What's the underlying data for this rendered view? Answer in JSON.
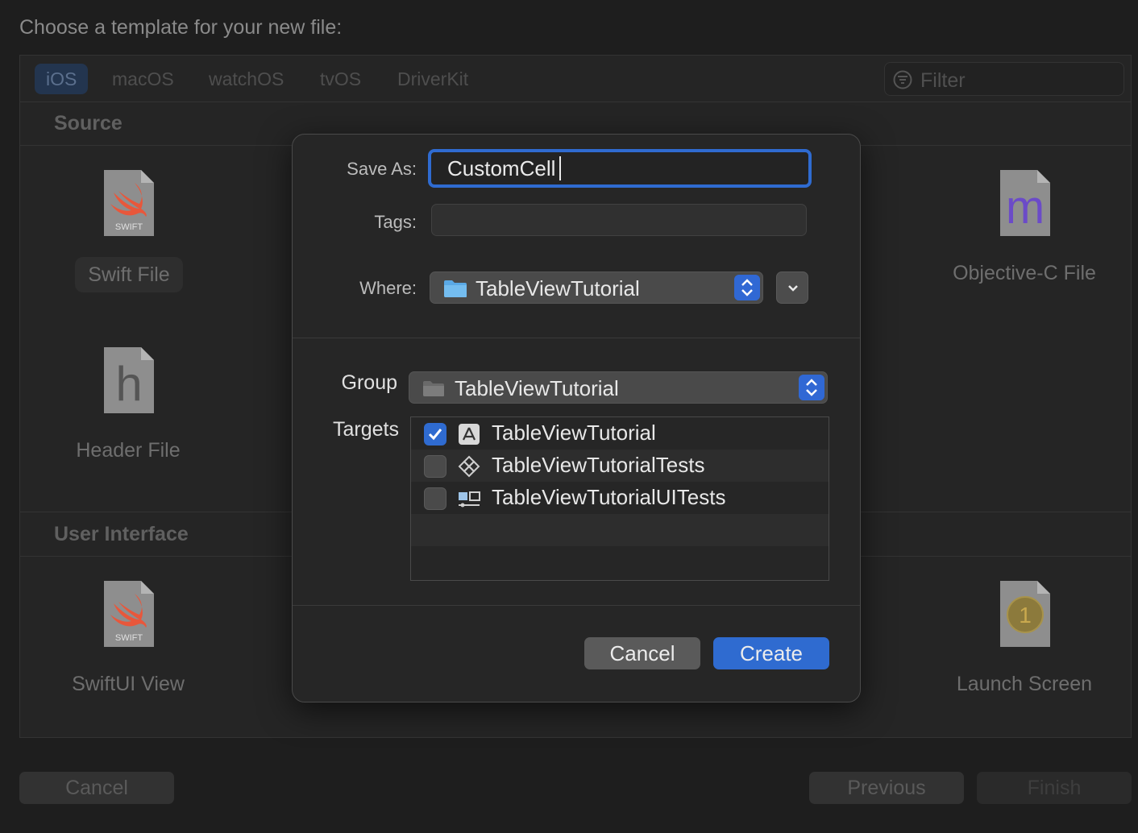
{
  "heading": "Choose a template for your new file:",
  "platforms": [
    "iOS",
    "macOS",
    "watchOS",
    "tvOS",
    "DriverKit"
  ],
  "filter_placeholder": "Filter",
  "sections": {
    "source": "Source",
    "user_interface": "User Interface"
  },
  "templates": {
    "swift_file": "Swift File",
    "objc_file": "Objective-C File",
    "header_file": "Header File",
    "swiftui_view": "SwiftUI View",
    "launch_screen": "Launch Screen",
    "swift_badge": "SWIFT",
    "objc_glyph": "m",
    "header_glyph": "h",
    "launch_glyph": "1"
  },
  "bottom_buttons": {
    "cancel": "Cancel",
    "previous": "Previous",
    "finish": "Finish"
  },
  "dialog": {
    "save_as_label": "Save As:",
    "save_as_value": "CustomCell",
    "tags_label": "Tags:",
    "tags_value": "",
    "where_label": "Where:",
    "where_value": "TableViewTutorial",
    "group_label": "Group",
    "group_value": "TableViewTutorial",
    "targets_label": "Targets",
    "targets": [
      {
        "name": "TableViewTutorial",
        "checked": true,
        "icon": "app-target-icon"
      },
      {
        "name": "TableViewTutorialTests",
        "checked": false,
        "icon": "unit-test-target-icon"
      },
      {
        "name": "TableViewTutorialUITests",
        "checked": false,
        "icon": "ui-test-target-icon"
      }
    ],
    "cancel": "Cancel",
    "create": "Create"
  },
  "colors": {
    "accent": "#2f6bd0",
    "background": "#1e1e1e",
    "dialog": "#262626",
    "folder": "#5aa9e6",
    "swift_orange": "#e8573b",
    "objc_purple": "#6b4bc8"
  }
}
